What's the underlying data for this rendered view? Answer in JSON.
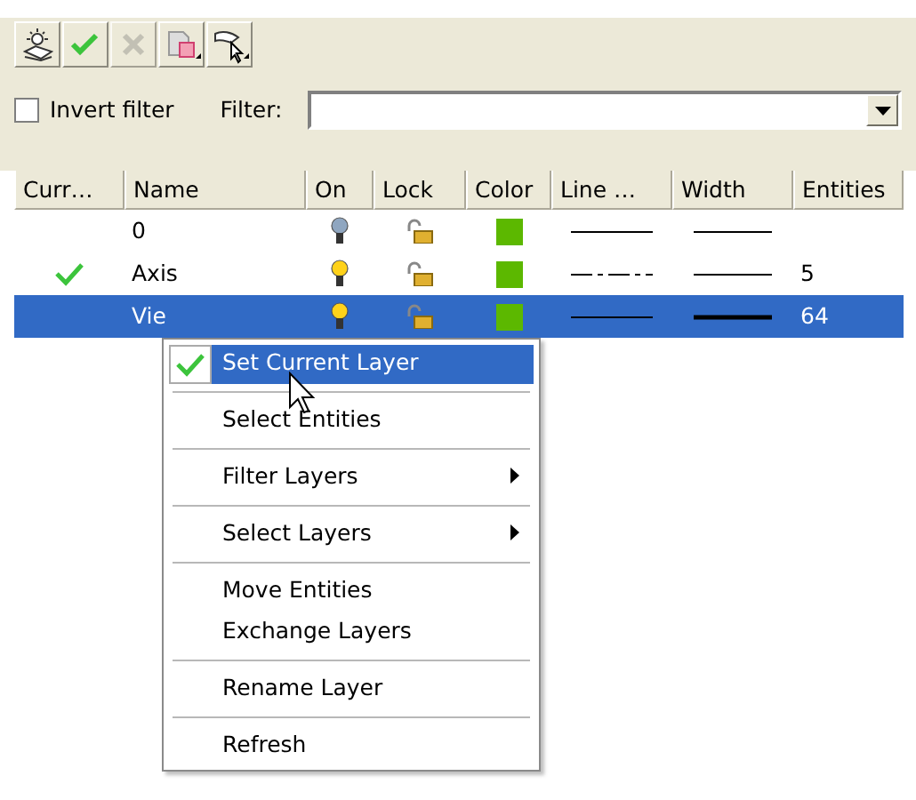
{
  "toolbar": [
    {
      "disabled": false
    },
    {
      "disabled": false
    },
    {
      "disabled": true
    },
    {
      "disabled": false
    },
    {
      "disabled": false
    }
  ],
  "invert_filter": {
    "label": "Invert filter",
    "checked": false
  },
  "filter": {
    "label": "Filter:"
  },
  "table": {
    "columns": [
      "Curr…",
      "Name",
      "On",
      "Lock",
      "Color",
      "Line …",
      "Width",
      "Entities"
    ],
    "rows": [
      {
        "current": false,
        "name": "0",
        "on": false,
        "locked": false,
        "color": "#5cb800",
        "dashed": false,
        "thick": false,
        "entities": "",
        "selected": false
      },
      {
        "current": true,
        "name": "Axis",
        "on": true,
        "locked": false,
        "color": "#5cb800",
        "dashed": true,
        "thick": false,
        "entities": "5",
        "selected": false
      },
      {
        "current": false,
        "name": "Vie",
        "on": true,
        "locked": false,
        "color": "#5cb800",
        "dashed": false,
        "thick": true,
        "entities": "64",
        "selected": true
      }
    ]
  },
  "context_menu": {
    "groups": [
      [
        {
          "label": "Set Current Layer",
          "checked": true,
          "submenu": false,
          "selected": true
        }
      ],
      [
        {
          "label": "Select Entities",
          "checked": false,
          "submenu": false,
          "selected": false
        }
      ],
      [
        {
          "label": "Filter Layers",
          "checked": false,
          "submenu": true,
          "selected": false
        }
      ],
      [
        {
          "label": "Select Layers",
          "checked": false,
          "submenu": true,
          "selected": false
        }
      ],
      [
        {
          "label": "Move Entities",
          "checked": false,
          "submenu": false,
          "selected": false
        },
        {
          "label": "Exchange Layers",
          "checked": false,
          "submenu": false,
          "selected": false
        }
      ],
      [
        {
          "label": "Rename Layer",
          "checked": false,
          "submenu": false,
          "selected": false
        }
      ],
      [
        {
          "label": "Refresh",
          "checked": false,
          "submenu": false,
          "selected": false
        }
      ]
    ]
  }
}
